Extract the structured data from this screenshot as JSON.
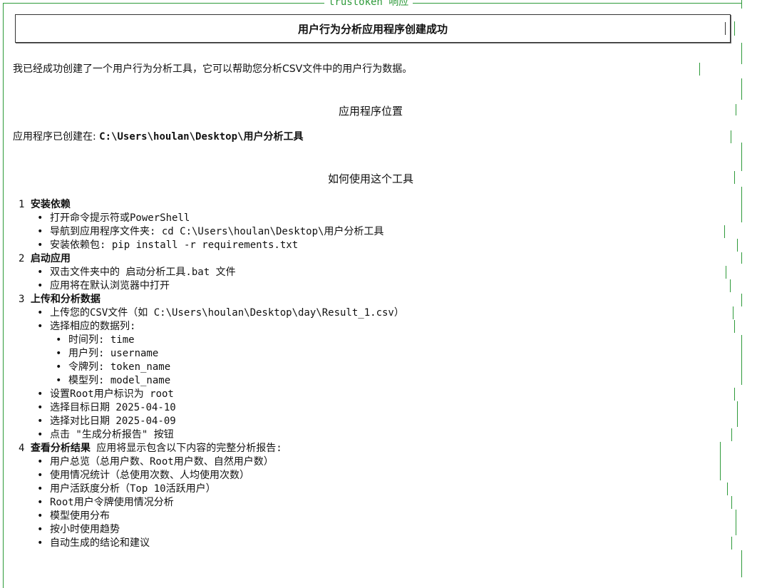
{
  "panel": {
    "title": "trustoken 响应"
  },
  "header": {
    "title": "用户行为分析应用程序创建成功"
  },
  "intro": "我已经成功创建了一个用户行为分析工具，它可以帮助您分析CSV文件中的用户行为数据。",
  "sections": {
    "location_title": "应用程序位置",
    "location_prefix": "应用程序已创建在: ",
    "location_path": "C:\\Users\\houlan\\Desktop\\用户分析工具",
    "usage_title": "如何使用这个工具"
  },
  "steps": [
    {
      "num": "1",
      "title": "安装依赖",
      "suffix": "",
      "items": [
        "打开命令提示符或PowerShell",
        "导航到应用程序文件夹: cd C:\\Users\\houlan\\Desktop\\用户分析工具",
        "安装依赖包: pip install -r requirements.txt"
      ]
    },
    {
      "num": "2",
      "title": "启动应用",
      "suffix": "",
      "items": [
        "双击文件夹中的 启动分析工具.bat 文件",
        "应用将在默认浏览器中打开"
      ]
    },
    {
      "num": "3",
      "title": "上传和分析数据",
      "suffix": "",
      "items": [
        "上传您的CSV文件（如 C:\\Users\\houlan\\Desktop\\day\\Result_1.csv）",
        "选择相应的数据列:"
      ],
      "sub_items": [
        "时间列: time",
        "用户列: username",
        "令牌列: token_name",
        "模型列: model_name"
      ],
      "items_after": [
        "设置Root用户标识为 root",
        "选择目标日期 2025-04-10",
        "选择对比日期 2025-04-09",
        "点击 \"生成分析报告\" 按钮"
      ]
    },
    {
      "num": "4",
      "title": "查看分析结果",
      "suffix": " 应用将显示包含以下内容的完整分析报告:",
      "items": [
        "用户总览（总用户数、Root用户数、自然用户数）",
        "使用情况统计（总使用次数、人均使用次数）",
        "用户活跃度分析（Top 10活跃用户）",
        "Root用户令牌使用情况分析",
        "模型使用分布",
        "按小时使用趋势",
        "自动生成的结论和建议"
      ]
    }
  ],
  "colors": {
    "accent": "#2e9a3a",
    "text": "#111111",
    "border": "#333333"
  }
}
